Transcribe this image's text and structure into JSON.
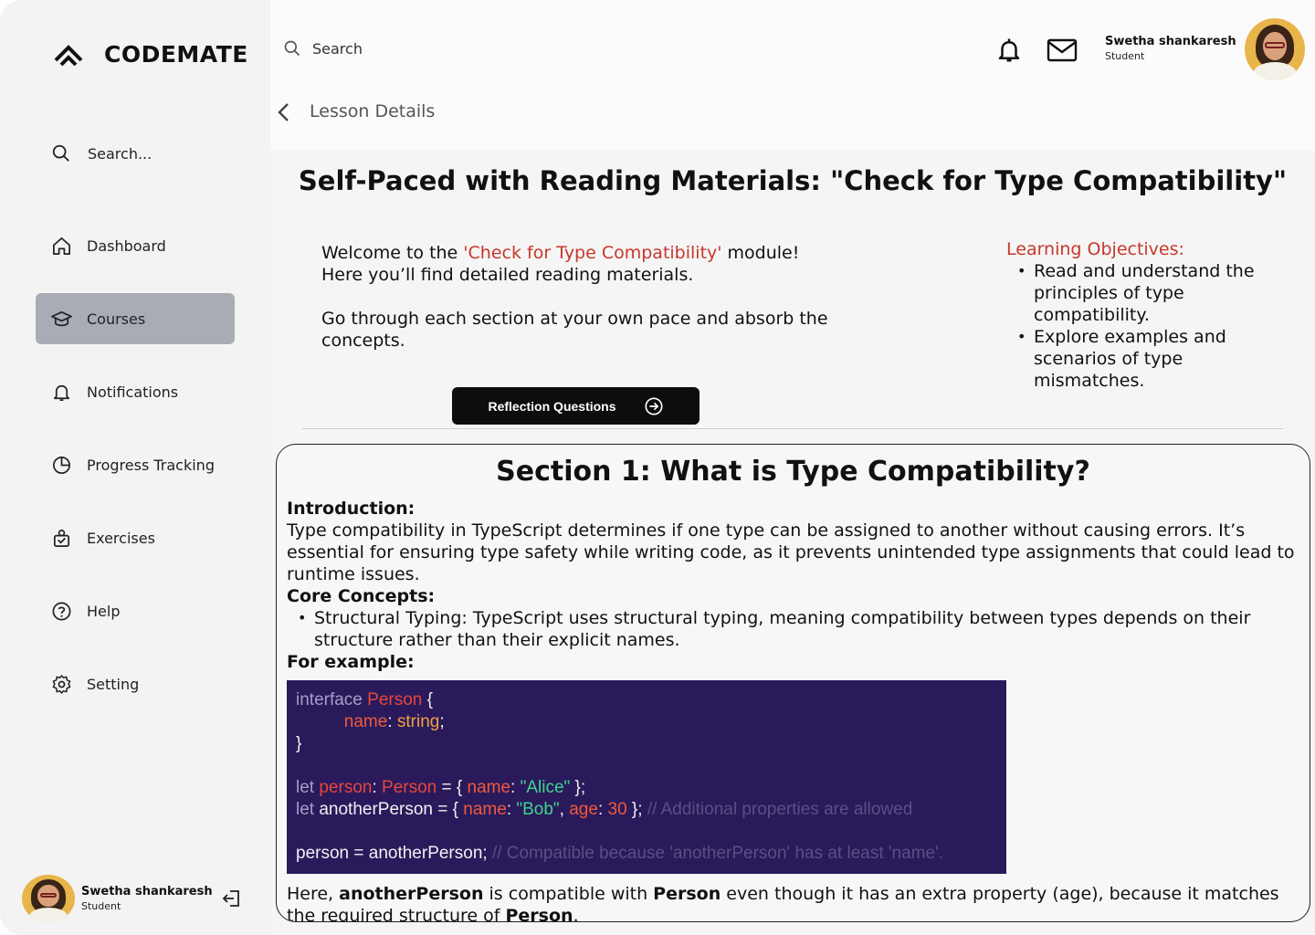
{
  "brand": {
    "name": "CODEMATE"
  },
  "sidebar": {
    "search_placeholder": "Search...",
    "items": [
      {
        "label": "Dashboard",
        "icon": "home-icon"
      },
      {
        "label": "Courses",
        "icon": "graduation-cap-icon",
        "active": true
      },
      {
        "label": "Notifications",
        "icon": "bell-icon"
      },
      {
        "label": "Progress Tracking",
        "icon": "pie-chart-icon"
      },
      {
        "label": "Exercises",
        "icon": "exercise-icon"
      },
      {
        "label": "Help",
        "icon": "help-icon"
      },
      {
        "label": "Setting",
        "icon": "gear-icon"
      }
    ],
    "user": {
      "name": "Swetha shankaresh",
      "role": "Student"
    }
  },
  "topbar": {
    "search_placeholder": "Search",
    "user": {
      "name": "Swetha shankaresh",
      "role": "Student"
    }
  },
  "breadcrumb": {
    "title": "Lesson Details"
  },
  "lesson": {
    "title": "Self-Paced with Reading Materials: \"Check for Type Compatibility\"",
    "intro_prefix": "Welcome to the ",
    "intro_highlight": "'Check for Type Compatibility'",
    "intro_suffix": " module! Here you’ll find detailed reading materials.",
    "intro_2": "Go through each section at your own pace and absorb the concepts.",
    "reflection_button": "Reflection Questions",
    "objectives_title": "Learning Objectives:",
    "objectives": [
      "Read and understand the principles of type compatibility.",
      "Explore examples and scenarios of type mismatches."
    ]
  },
  "section": {
    "title": "Section 1: What is Type Compatibility?",
    "intro_label": "Introduction:",
    "intro_text": "Type compatibility in TypeScript determines if one type can be assigned to another without causing errors. It’s essential for ensuring type safety while writing code, as it prevents unintended type assignments that could lead to runtime issues.",
    "core_label": "Core Concepts:",
    "core_items": [
      "Structural Typing: TypeScript uses structural typing, meaning compatibility between types depends on their structure rather than their explicit names."
    ],
    "example_label": "For example:",
    "after_1": "Here, ",
    "after_b1": "anotherPerson",
    "after_2": " is compatible with ",
    "after_b2": "Person",
    "after_3": " even though it has an extra property (age), because it matches the required structure of ",
    "after_b3": "Person",
    "after_4": "."
  },
  "code": {
    "l1_kw": "interface ",
    "l1_ty": "Person",
    "l1_rest": " {",
    "l2_pr": "name",
    "l2_colon": ": ",
    "l2_ts": "string",
    "l2_end": ";",
    "l3": "}",
    "l5_kw": "let ",
    "l5_var": "person",
    "l5_c": ": ",
    "l5_ty": "Person",
    "l5_eq": " = { ",
    "l5_pr": "name",
    "l5_c2": ": ",
    "l5_st": "\"Alice\"",
    "l5_end": " };",
    "l6_kw": "let ",
    "l6_var": "anotherPerson = { ",
    "l6_pr": "name",
    "l6_c": ": ",
    "l6_st": "\"Bob\"",
    "l6_comma": ", ",
    "l6_pr2": "age",
    "l6_c2": ": ",
    "l6_num": "30",
    "l6_end": " }; ",
    "l6_cm": "// Additional properties are allowed",
    "l8_a": "person = anotherPerson; ",
    "l8_cm": "// Compatible because 'anotherPerson' has at least 'name'."
  },
  "colors": {
    "accent": "#c8362b",
    "active_nav": "#a9acb4",
    "code_bg": "#2a1a5c"
  }
}
